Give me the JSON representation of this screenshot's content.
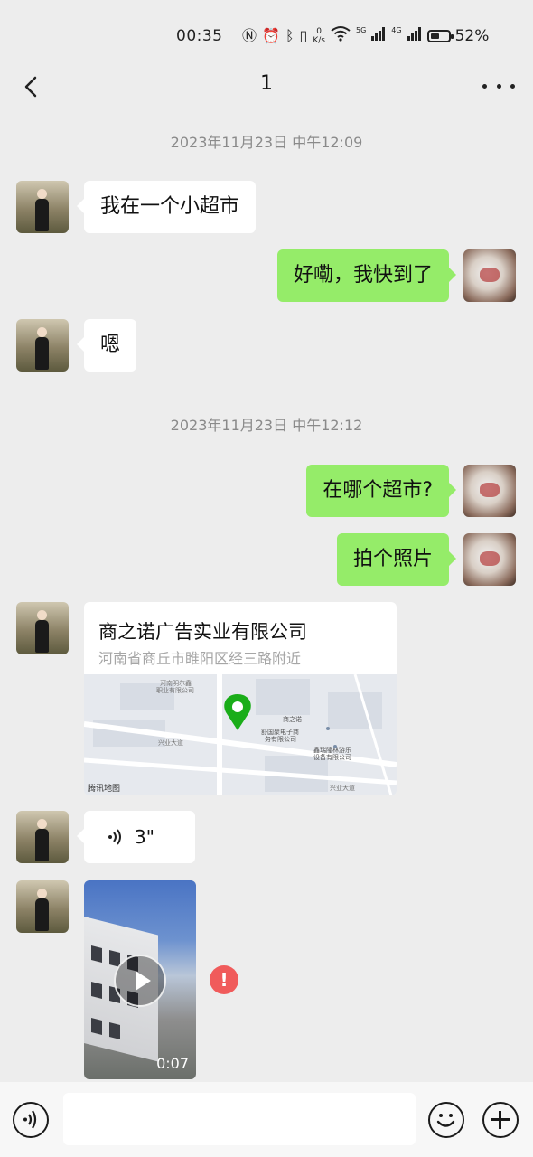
{
  "status_bar": {
    "time": "00:35",
    "speed_value": "0",
    "speed_unit": "K/s",
    "net1": "5G",
    "net2": "4G",
    "battery_text": "52%",
    "battery_level": 0.52
  },
  "header": {
    "title": "1"
  },
  "messages": {
    "timestamp_1": "2023年11月23日 中午12:09",
    "msg_1": "我在一个小超市",
    "msg_2": "好嘞，我快到了",
    "msg_3": "嗯",
    "timestamp_2": "2023年11月23日 中午12:12",
    "msg_4": "在哪个超市?",
    "msg_5": "拍个照片",
    "location": {
      "name": "商之诺广告实业有限公司",
      "address": "河南省商丘市睢阳区经三路附近",
      "map_labels": [
        "河南明尔鑫",
        "职业有限公司",
        "兴业大道",
        "商之诺",
        "舒国聚电子商",
        "务有限公司",
        "鑫瑞隆林游乐",
        "设备有限公司",
        "兴业大道"
      ],
      "map_logo": "腾讯地图"
    },
    "voice_duration": "3\"",
    "video_duration": "0:07",
    "error_mark": "!"
  },
  "input_bar": {
    "value": "",
    "placeholder": ""
  },
  "colors": {
    "background": "#ededed",
    "bubble_self": "#95ec69",
    "bubble_other": "#ffffff",
    "error": "#f05b5b"
  }
}
